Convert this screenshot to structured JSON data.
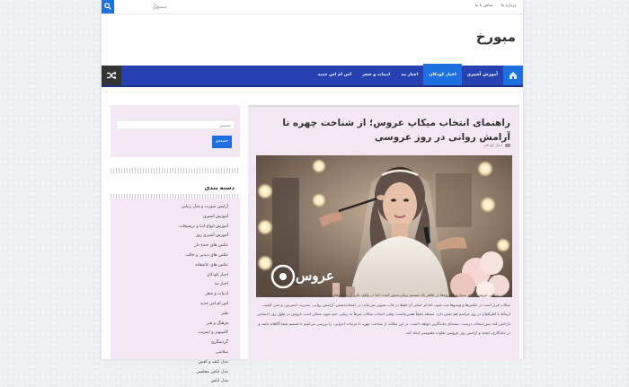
{
  "topbar": {
    "search_placeholder": "جستجو ...",
    "links": [
      "درباره ما",
      "تماس با ما"
    ]
  },
  "site": {
    "logo": "مبورخ"
  },
  "nav": {
    "items": [
      {
        "label": "آموزش آشپزی",
        "active": false
      },
      {
        "label": "اخبار کودکان",
        "active": true
      },
      {
        "label": "اخبار مد",
        "active": false
      },
      {
        "label": "ادبیات و شعر",
        "active": false
      },
      {
        "label": "اس ام اس جدید",
        "active": false
      }
    ]
  },
  "post": {
    "title": "راهنمای انتخاب میکاپ عروس؛ از شناخت چهره تا آرامش روانی در روز عروسی",
    "category": "اخبار کودکان",
    "photo_watermark": "عروس",
    "excerpt": "انتخاب میکاپ عروس، برای بسیاری از زوج‌ها در ظاهر یک تصمیم زیبایی‌محور است؛ اما در واقع، یکی از تصمیم‌های تجربه‌محور مسیر عروسی محسوب می‌شود. میکاپ قرار است در عکس‌ها و ویدیوها ثبت شود، اما اثر اصلی آن فقط در قاب تصویر نمی‌ماند؛ در اعتمادبه‌نفس، آرامش روانی، مدیریت استرس، و حتی کیفیت ارتباط با اطرافیان در روز مراسم هم نقش دارد. مسئله دقیقاً همین‌جاست: وقتی انتخاب میکاپ صرفاً به زیبایی ختم شود، ممکن است عروس در طول روز احساس ناراحتی کند؛ پس انتخاب درست، نتیجه‌ای ماندگارتر خواهد داشت. در این مقاله، از شناخت چهره تا جزئیات اجرایی، را بررسی می‌کنیم تا تصمیم شما آگاهانه باشد و در ماندگاری، لبخند و آرامش روز عروسی تفاوت ملموسی ایجاد کند."
  },
  "sidebar": {
    "search": {
      "placeholder": "جستجو",
      "button": "جستجو"
    },
    "categories_title": "دسته بندی",
    "categories": [
      "آرایش صورت و مدل زیبایی",
      "آموزش آشپزی",
      "آموزش انواع ادیا و ترشیجات",
      "آموزش آشپزی روز",
      "عکس های خنده دار",
      "عکس های دیدنی و جالب",
      "عکس های عاشقانه",
      "اخبار کودکان",
      "اخبار مد",
      "ادبیات و شعر",
      "اس ام اس جدید",
      "طنز",
      "فرهنگ و هنر",
      "کامپیوتر و اینترنت",
      "گردشگری",
      "سلامتی",
      "مدل کیف و کفش",
      "مدل لباس مجلسی",
      "مدل لباس"
    ]
  },
  "colors": {
    "accent": "#1e6fe0",
    "nav": "#2541b2",
    "article_bg": "#f3e7f3"
  }
}
